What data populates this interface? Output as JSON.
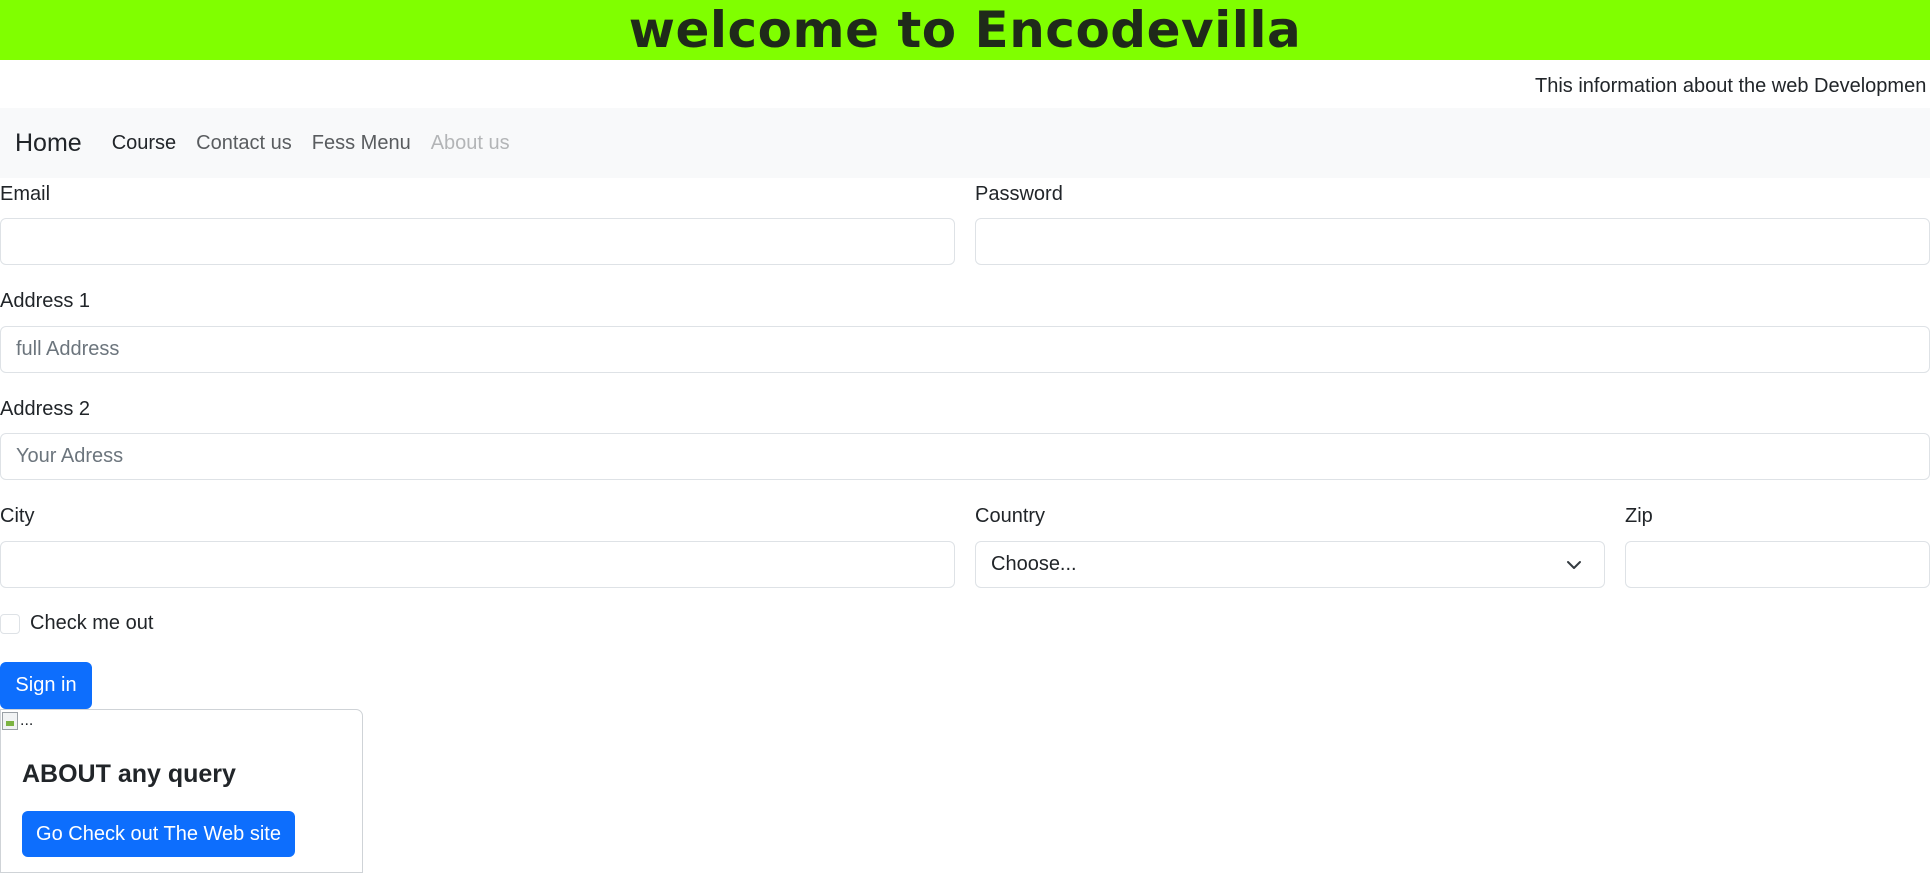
{
  "banner": {
    "title": "welcome to Encodevilla",
    "background": "#80ff00"
  },
  "marquee": {
    "text": "This information about the web Developmen"
  },
  "navbar": {
    "brand": "Home",
    "links": [
      {
        "label": "Course",
        "state": "active"
      },
      {
        "label": "Contact us",
        "state": "normal"
      },
      {
        "label": "Fess Menu",
        "state": "normal"
      },
      {
        "label": "About us",
        "state": "disabled"
      }
    ]
  },
  "form": {
    "email": {
      "label": "Email",
      "value": "",
      "placeholder": ""
    },
    "password": {
      "label": "Password",
      "value": "",
      "placeholder": ""
    },
    "address1": {
      "label": "Address 1",
      "value": "",
      "placeholder": "full Address"
    },
    "address2": {
      "label": "Address 2",
      "value": "",
      "placeholder": "Your Adress"
    },
    "city": {
      "label": "City",
      "value": "",
      "placeholder": ""
    },
    "country": {
      "label": "Country",
      "selected": "Choose..."
    },
    "zip": {
      "label": "Zip",
      "value": "",
      "placeholder": ""
    },
    "checkbox": {
      "label": "Check me out",
      "checked": false
    },
    "submit_label": "Sign in"
  },
  "card": {
    "image_alt": "...",
    "title": "ABOUT any query",
    "button_label": "Go Check out The Web site"
  },
  "colors": {
    "primary": "#0d6efd",
    "navbar_bg": "#f8f9fa",
    "banner_bg": "#80ff00"
  },
  "icons": {
    "select_arrow": "chevron-down-icon",
    "broken_image": "broken-image-icon"
  }
}
